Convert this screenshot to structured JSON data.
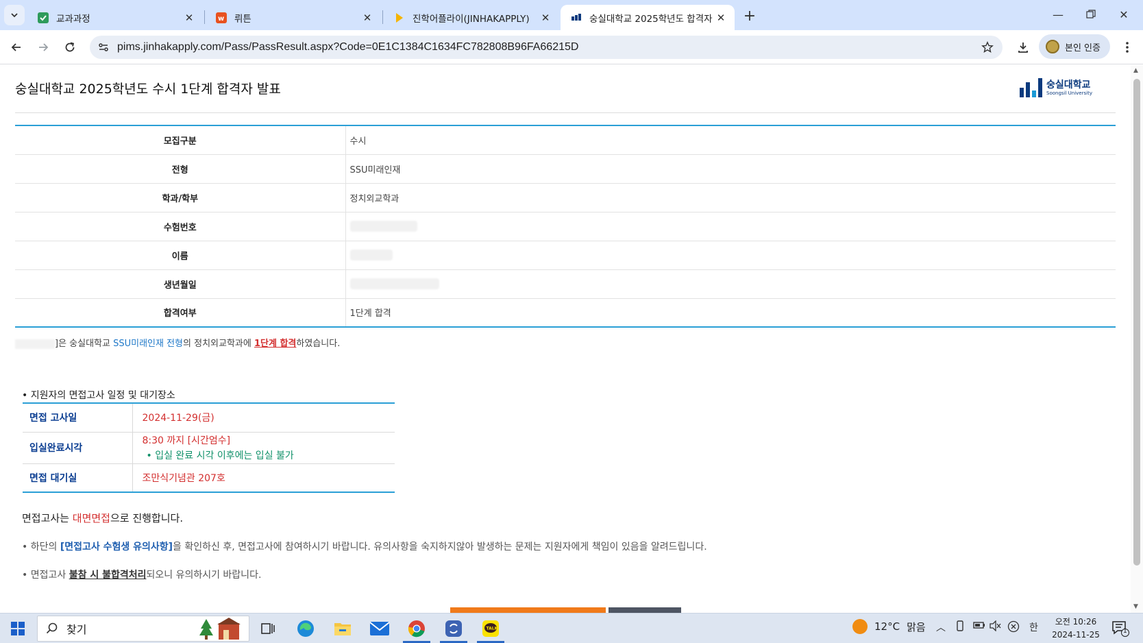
{
  "browser": {
    "tabs": [
      {
        "title": "교과과정",
        "active": false
      },
      {
        "title": "뤼튼",
        "active": false
      },
      {
        "title": "진학어플라이(JINHAKAPPLY)",
        "active": false
      },
      {
        "title": "숭실대학교 2025학년도 합격자",
        "active": true
      }
    ],
    "url": "pims.jinhakapply.com/Pass/PassResult.aspx?Code=0E1C1384C1634FC782808B96FA66215D",
    "profile_chip_label": "본인 인증"
  },
  "page": {
    "title": "숭실대학교 2025학년도 수시 1단계 합격자 발표",
    "logo": {
      "ko": "숭실대학교",
      "en": "Soongsil University",
      "color": "#0b3a7e"
    },
    "result_rows": [
      {
        "label": "모집구분",
        "value": "수시"
      },
      {
        "label": "전형",
        "value": "SSU미래인재"
      },
      {
        "label": "학과/학부",
        "value": "정치외교학과"
      },
      {
        "label": "수험번호",
        "value": ""
      },
      {
        "label": "이름",
        "value": ""
      },
      {
        "label": "생년월일",
        "value": ""
      },
      {
        "label": "합격여부",
        "value": "1단계 합격"
      }
    ],
    "summary": {
      "prefix": "]은 숭실대학교 ",
      "track": "SSU미래인재 전형",
      "mid": "의 정치외교학과에 ",
      "result": "1단계 합격",
      "suffix": "하였습니다."
    },
    "schedule": {
      "heading": "• 지원자의 면접고사 일정 및 대기장소",
      "rows": [
        {
          "label": "면접 고사일",
          "value": "2024-11-29(금)"
        },
        {
          "label": "입실완료시각",
          "value": "8:30 까지 [시간엄수]",
          "note": "• 입실 완료 시각 이후에는 입실 불가"
        },
        {
          "label": "면접 대기실",
          "value": "조만식기념관 207호"
        }
      ]
    },
    "notice1": {
      "a": "면접고사는 ",
      "b": "대면면접",
      "c": "으로 진행합니다."
    },
    "notice2": {
      "a": "• 하단의 ",
      "b": "[면접고사 수험생 유의사항]",
      "c": "을 확인하신 후, 면접고사에 참여하시기 바랍니다. 유의사항을 숙지하지않아 발생하는 문제는 지원자에게 책임이 있음을 알려드립니다."
    },
    "notice3": {
      "a": "• 면접고사 ",
      "b": "불참 시 불합격처리",
      "c": "되오니 유의하시기 바랍니다."
    },
    "accent_colors": {
      "blue_border": "#2a9fd6",
      "red": "#d32f2f",
      "green": "#11916a",
      "orange_button": "#f07a1a"
    }
  },
  "taskbar": {
    "search_label": "찾기",
    "weather": {
      "temp": "12°C",
      "condition": "맑음"
    },
    "ime": "한",
    "clock": {
      "time": "오전 10:26",
      "date": "2024-11-25"
    },
    "notification_count": "1",
    "icons": [
      "windows-start-icon",
      "search-icon",
      "task-view-icon",
      "edge-icon",
      "file-explorer-icon",
      "mail-icon",
      "chrome-icon",
      "app-icon",
      "kakaotalk-icon"
    ]
  }
}
